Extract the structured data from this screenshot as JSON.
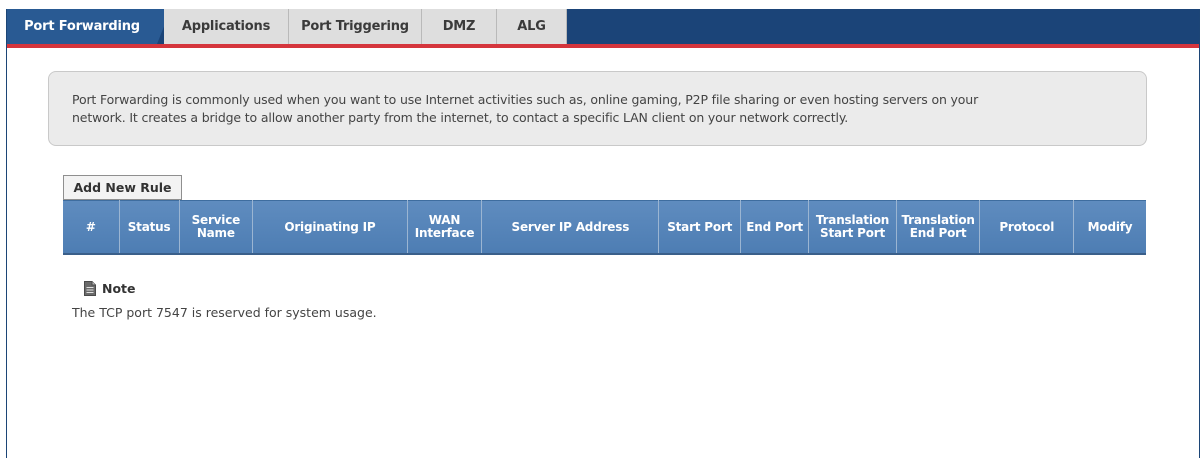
{
  "tabs": [
    {
      "label": "Port Forwarding",
      "active": true
    },
    {
      "label": "Applications",
      "active": false
    },
    {
      "label": "Port Triggering",
      "active": false
    },
    {
      "label": "DMZ",
      "active": false
    },
    {
      "label": "ALG",
      "active": false
    }
  ],
  "info": {
    "line1": "Port Forwarding is commonly used when you want to use Internet activities such as, online gaming, P2P file sharing or even hosting servers on your",
    "line2": "network. It creates a bridge to allow another party from the internet, to contact a specific LAN client on your network correctly."
  },
  "add_rule_label": "Add New Rule",
  "table": {
    "columns": [
      "#",
      "Status",
      "Service\nName",
      "Originating IP",
      "WAN\nInterface",
      "Server IP Address",
      "Start Port",
      "End Port",
      "Translation\nStart Port",
      "Translation\nEnd Port",
      "Protocol",
      "Modify"
    ],
    "rows": []
  },
  "note": {
    "title": "Note",
    "text": "The TCP port 7547 is reserved for system usage.",
    "icon": "document-icon"
  },
  "colors": {
    "tabbar": "#1b4478",
    "active_tab": "#295a93",
    "accent_red": "#d5353c",
    "table_header": "#5584b8"
  }
}
